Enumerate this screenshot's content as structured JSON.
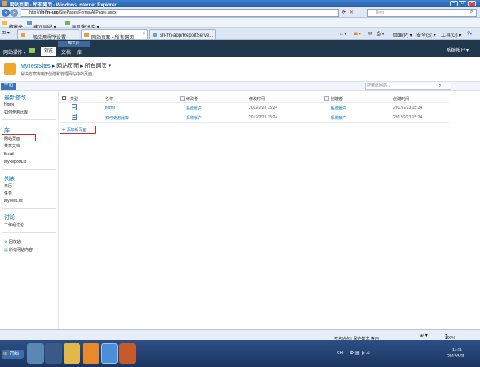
{
  "browser": {
    "title": "网站页面 - 所有网页 - Windows Internet Explorer",
    "url_prefix": "http://",
    "url_host": "sh-fm-app",
    "url_path": "/SitePages/Forms/AllPages.aspx",
    "search_placeholder": "Bing",
    "favorites_label": "收藏夹",
    "fav_items": [
      "建议网站 ▾",
      "网页快讯库 ▾"
    ],
    "tabs": [
      "一般应用程序设置",
      "网站页面 - 所有网页",
      "sh-fm-app/ReportServe..."
    ],
    "cmd_items": [
      "页面(P) ▾",
      "安全(S) ▾",
      "工具(O) ▾"
    ]
  },
  "ribbon": {
    "site_actions": "网站操作 ▾",
    "browse": "浏览",
    "context_group": "库工具",
    "tab_docs": "文档",
    "tab_library": "库",
    "user": "系统帐户 ▾"
  },
  "header": {
    "site_name": "MyTestSites",
    "crumb_sep1": "▸",
    "crumb_mid": "网站页面",
    "crumb_sep2": "▸",
    "crumb_last": "所有网页 ▾",
    "description": "解决方案库用于创建和管理网站中的页面。"
  },
  "topnav": {
    "home": "主页",
    "search_placeholder": "搜索此网站..."
  },
  "leftnav": {
    "recent_heading": "最新修改",
    "recent_items": [
      "Home",
      "如何使用此库"
    ],
    "lib_heading": "库",
    "lib_items": [
      "网站页面",
      "共享文档",
      "Email",
      "MyReportLib"
    ],
    "lists_heading": "列表",
    "lists_items": [
      "日历",
      "任务",
      "MyTestList"
    ],
    "disc_heading": "讨论",
    "disc_items": [
      "工作组讨论"
    ],
    "bottom_items": [
      "回收站",
      "所有网站内容"
    ]
  },
  "list": {
    "columns": [
      "类型",
      "名称",
      "修改者",
      "修改时间",
      "创建者",
      "创建时间"
    ],
    "rows": [
      {
        "name": "Home",
        "modified_by": "系统帐户",
        "modified": "2012/2/23 15:24",
        "created_by": "系统帐户",
        "created": "2012/2/23 15:24"
      },
      {
        "name": "如何使用此库",
        "modified_by": "系统帐户",
        "modified": "2012/2/23 15:24",
        "created_by": "系统帐户",
        "created": "2012/2/23 15:24"
      }
    ],
    "add_new": "添加新页面"
  },
  "status": {
    "zone": "可信站点 | 保护模式: 禁用",
    "zoom": "100%"
  },
  "taskbar": {
    "start": "开始",
    "lang": "CH",
    "time": "11:11",
    "date": "2012/5/11"
  },
  "colors": {
    "ribbon_bg": "#21374c",
    "link": "#0072bc",
    "highlight_box": "#c8302f",
    "taskbar": "#1b355f"
  }
}
